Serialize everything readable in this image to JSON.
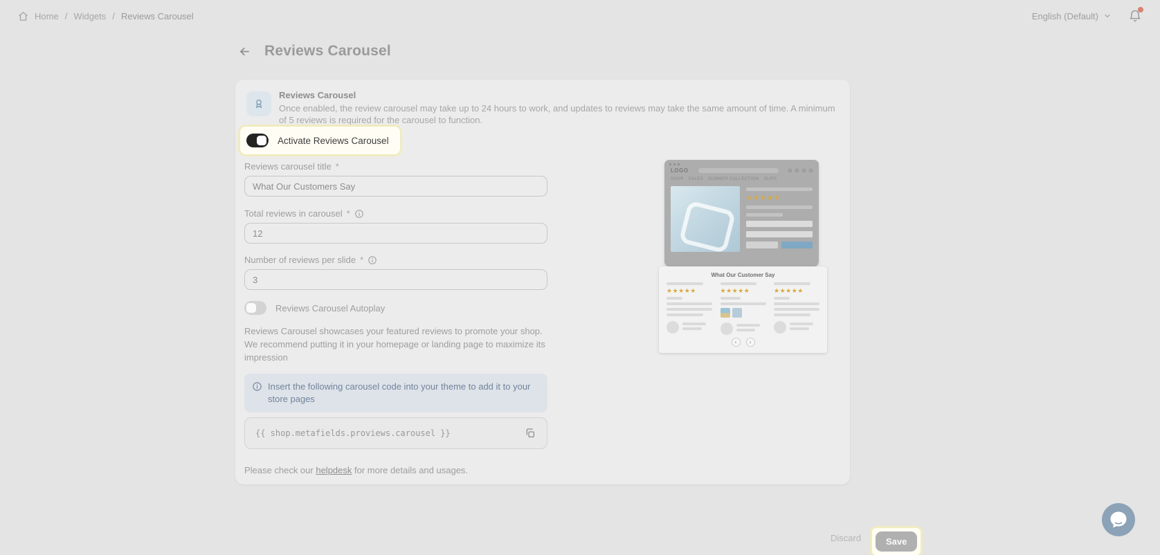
{
  "colors": {
    "spotlight_border": "#f0ebc0",
    "notification_dot": "#d9826f",
    "info_text": "#71839c",
    "star_gold": "#d9a93f",
    "preview_accent_blue": "#7fa8c4",
    "chat_bubble_bg": "#8ba2b7",
    "toggle_on": "#232323"
  },
  "topbar": {
    "breadcrumb": {
      "separator": "/",
      "items": [
        {
          "label": "Home"
        },
        {
          "label": "Widgets"
        },
        {
          "label": "Reviews Carousel"
        }
      ]
    },
    "language_selector": "English (Default)"
  },
  "page": {
    "title": "Reviews Carousel"
  },
  "card": {
    "header": {
      "title": "Reviews Carousel",
      "description": "Once enabled, the review carousel may take up to 24 hours to work, and updates to reviews may take the same amount of time. A minimum of 5 reviews is required for the carousel to function."
    },
    "activate_toggle": {
      "label": "Activate Reviews Carousel",
      "state": "on"
    },
    "fields": {
      "title": {
        "label": "Reviews carousel title",
        "required_mark": "*",
        "value": "What Our Customers Say"
      },
      "total": {
        "label": "Total reviews in carousel",
        "required_mark": "*",
        "value": "12"
      },
      "per_slide": {
        "label": "Number of reviews per slide",
        "required_mark": "*",
        "value": "3"
      }
    },
    "autoplay_toggle": {
      "label": "Reviews Carousel Autoplay",
      "state": "off"
    },
    "description": "Reviews Carousel showcases your featured reviews to promote your shop. We recommend putting it in your homepage or landing page to maximize its impression",
    "info_banner": {
      "text": "Insert the following carousel code into your theme to add it to your store pages"
    },
    "code_block": {
      "code": "{{ shop.metafields.proviews.carousel }}"
    },
    "helpdesk_note": {
      "prefix": "Please check our ",
      "link_text": "helpdesk",
      "suffix": " for more details and usages."
    }
  },
  "preview": {
    "store_mock": {
      "logo": "LOGO",
      "nav_items": [
        {
          "label": "SHOP"
        },
        {
          "label": "SALES"
        },
        {
          "label": "SUMMER COLLECTION"
        },
        {
          "label": "SLIPS"
        }
      ],
      "stars": "★★★★★"
    },
    "carousel_mock": {
      "title": "What Our Customer Say",
      "stars": "★★★★★",
      "prev_arrow": "‹",
      "next_arrow": "›"
    }
  },
  "footer": {
    "discard_label": "Discard",
    "save_label": "Save"
  }
}
